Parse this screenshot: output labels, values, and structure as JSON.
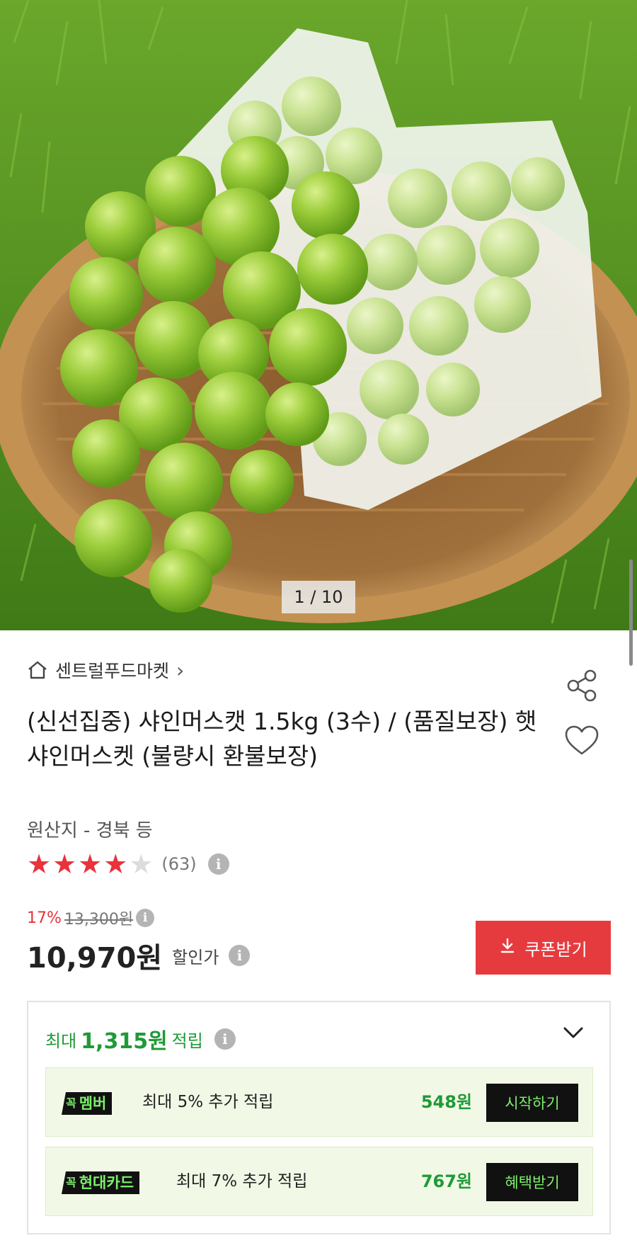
{
  "gallery": {
    "counter": "1 / 10",
    "image_subject": "shine-muscat-grapes-in-bamboo-basket"
  },
  "store": {
    "name": "센트럴푸드마켓",
    "home_icon": "home-icon",
    "chevron": "›"
  },
  "product": {
    "title": "(신선집중) 샤인머스캣 1.5kg (3수) / (품질보장) 햇 샤인머스켓 (불량시 환불보장)",
    "origin": "원산지 - 경북 등",
    "rating_stars": 4,
    "rating_max": 5,
    "review_count": "(63)"
  },
  "price": {
    "discount_rate": "17%",
    "original": "13,300원",
    "sale": "10,970원",
    "sale_label": "할인가",
    "coupon_button": "쿠폰받기"
  },
  "points": {
    "prefix": "최대",
    "amount": "1,315원",
    "suffix": "적립",
    "benefits": [
      {
        "badge_mark": "꼭",
        "badge_label": "멤버",
        "text": "최대 5% 추가 적립",
        "amount": "548원",
        "button": "시작하기"
      },
      {
        "badge_mark": "꼭",
        "badge_label": "현대카드",
        "text": "최대 7% 추가 적립",
        "amount": "767원",
        "button": "혜택받기"
      }
    ]
  },
  "colors": {
    "accent_red": "#e63b3e",
    "point_green": "#1f9a36",
    "badge_green": "#7cf06a",
    "star_red": "#e8323c"
  }
}
